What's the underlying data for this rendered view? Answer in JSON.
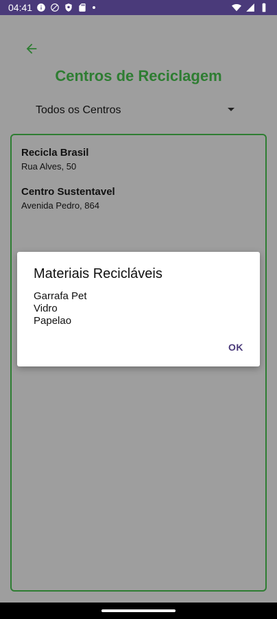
{
  "status_bar": {
    "time": "04:41",
    "left_icons": [
      "info-icon",
      "circle-slash-icon",
      "shield-icon",
      "sd-card-icon",
      "dot-icon"
    ],
    "right_icons": [
      "wifi-icon",
      "cellular-signal-icon",
      "battery-icon"
    ]
  },
  "header": {
    "title": "Centros de Reciclagem",
    "back_icon": "arrow-back-icon"
  },
  "filter": {
    "selected": "Todos os Centros"
  },
  "centers": [
    {
      "name": "Recicla Brasil",
      "address": "Rua Alves, 50"
    },
    {
      "name": "Centro Sustentavel",
      "address": "Avenida Pedro, 864"
    }
  ],
  "dialog": {
    "title": "Materiais Recicláveis",
    "items": [
      "Garrafa Pet",
      "Vidro",
      "Papelao"
    ],
    "ok_label": "OK"
  },
  "colors": {
    "accent_green": "#2e7d32",
    "status_bar": "#4a3a7a",
    "scrim_background": "#9e9e9e"
  }
}
